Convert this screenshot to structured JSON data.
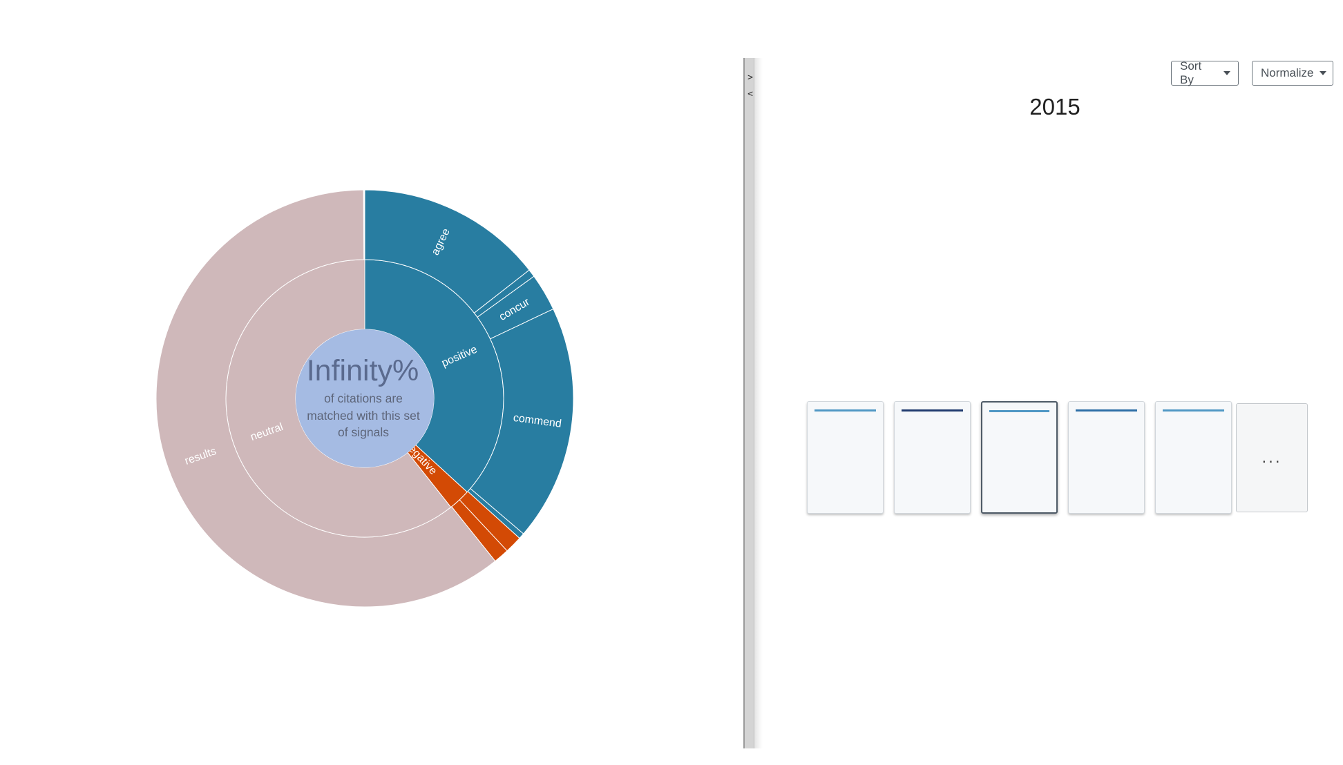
{
  "sunburst": {
    "center_value": "Infinity%",
    "center_caption": "of citations are matched with this set of signals",
    "center_color": "#a5bbe3",
    "colors": {
      "positive": "#287da1",
      "negative": "#d34a05",
      "neutral": "#cfb8ba",
      "divider": "#ffffff"
    }
  },
  "chart_data": {
    "type": "sunburst",
    "inner_ring": [
      {
        "label": "positive",
        "share": 0.368,
        "color": "#287da1"
      },
      {
        "label": "negative",
        "share": 0.0255,
        "color": "#d34a05"
      },
      {
        "label": "neutral",
        "share": 0.6065,
        "color": "#cfb8ba"
      }
    ],
    "outer_ring": [
      {
        "label": "agree",
        "parent": "positive",
        "share": 0.1445,
        "color": "#287da1"
      },
      {
        "label": "",
        "parent": "positive",
        "share": 0.006,
        "color": "#287da1"
      },
      {
        "label": "concur",
        "parent": "positive",
        "share": 0.029,
        "color": "#287da1"
      },
      {
        "label": "commend",
        "parent": "positive",
        "share": 0.183,
        "color": "#287da1"
      },
      {
        "label": "",
        "parent": "positive",
        "share": 0.0045,
        "color": "#287da1"
      },
      {
        "label": "",
        "parent": "negative",
        "share": 0.0135,
        "color": "#d34a05"
      },
      {
        "label": "",
        "parent": "negative",
        "share": 0.012,
        "color": "#d34a05"
      },
      {
        "label": "results",
        "parent": "neutral",
        "share": 0.6065,
        "color": "#cfb8ba"
      }
    ]
  },
  "toolbar": {
    "sort_by_label": "Sort By",
    "normalize_label": "Normalize"
  },
  "year": "2015",
  "thumbnails": [
    {
      "bar_color": "#4f97c4",
      "selected": false
    },
    {
      "bar_color": "#1f3a6e",
      "selected": false
    },
    {
      "bar_color": "#4f97c4",
      "selected": true
    },
    {
      "bar_color": "#2c6ea6",
      "selected": false
    },
    {
      "bar_color": "#4f97c4",
      "selected": false
    }
  ],
  "more_label": "...",
  "splitter": {
    "expand_glyph": ">",
    "collapse_glyph": "<"
  }
}
